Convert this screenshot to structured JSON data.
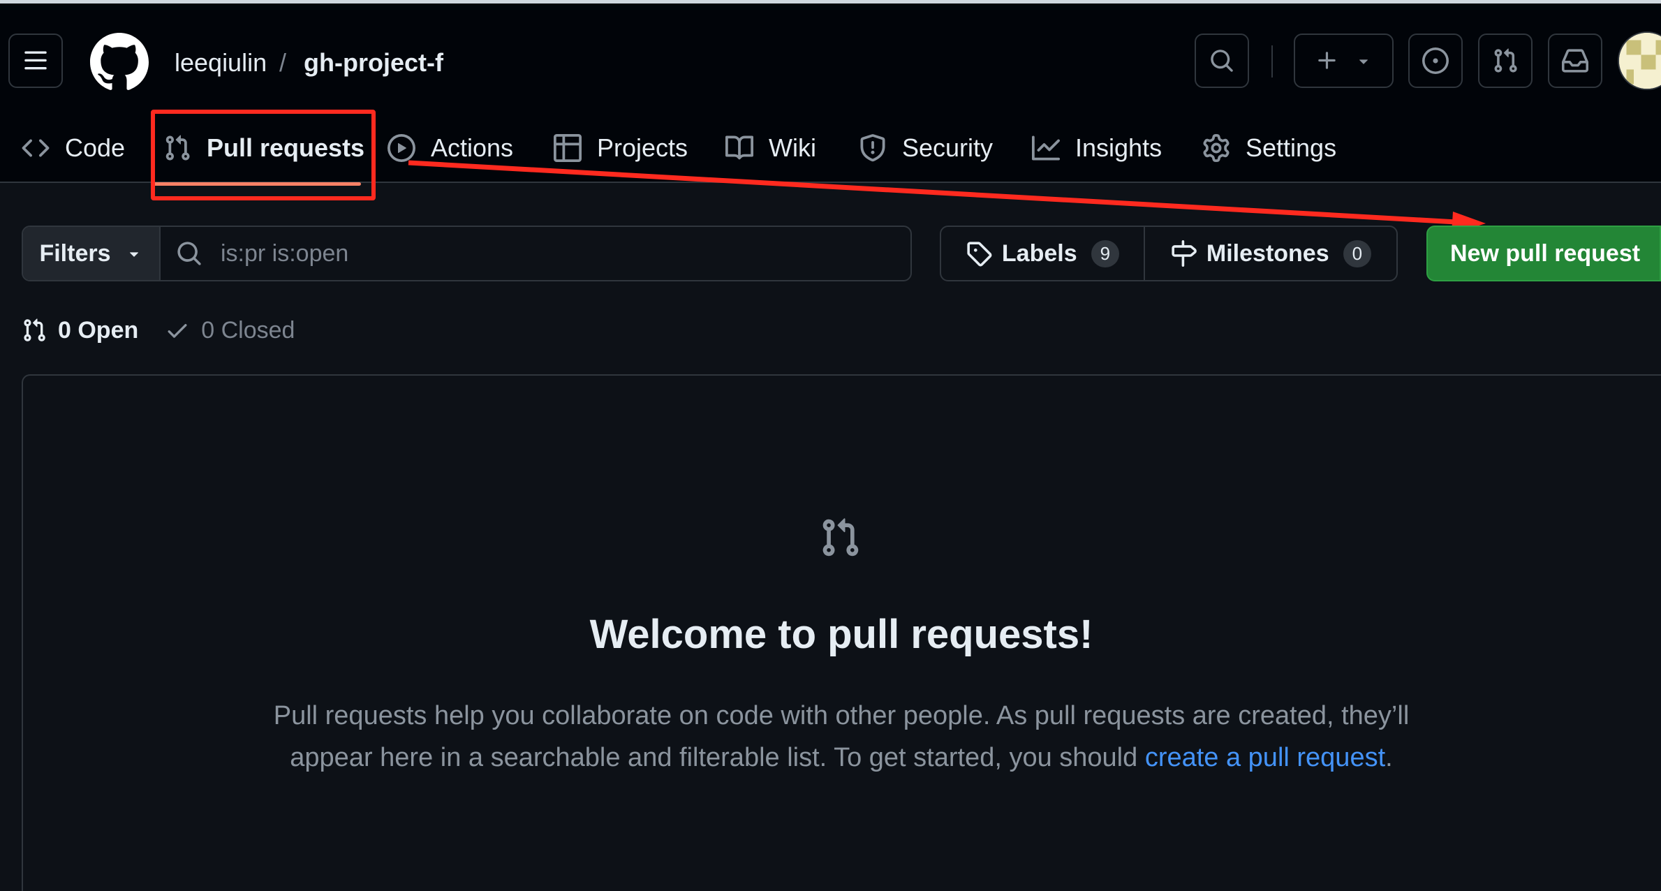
{
  "header": {
    "owner": "leeqiulin",
    "separator": "/",
    "repo": "gh-project-f"
  },
  "nav": {
    "items": [
      {
        "label": "Code",
        "icon": "code-icon"
      },
      {
        "label": "Pull requests",
        "icon": "git-pull-request-icon",
        "active": true
      },
      {
        "label": "Actions",
        "icon": "play-icon"
      },
      {
        "label": "Projects",
        "icon": "table-icon"
      },
      {
        "label": "Wiki",
        "icon": "book-icon"
      },
      {
        "label": "Security",
        "icon": "shield-icon"
      },
      {
        "label": "Insights",
        "icon": "graph-icon"
      },
      {
        "label": "Settings",
        "icon": "gear-icon"
      }
    ]
  },
  "filters": {
    "button_label": "Filters",
    "search_value": "is:pr is:open",
    "labels_label": "Labels",
    "labels_count": "9",
    "milestones_label": "Milestones",
    "milestones_count": "0",
    "new_pr_label": "New pull request"
  },
  "state": {
    "open_label": "0 Open",
    "closed_label": "0 Closed"
  },
  "blankslate": {
    "title": "Welcome to pull requests!",
    "text_before": "Pull requests help you collaborate on code with other people. As pull requests are created, they’ll appear here in a searchable and filterable list. To get started, you should ",
    "link_text": "create a pull request",
    "text_after": "."
  },
  "colors": {
    "background": "#0d1117",
    "header": "#010409",
    "accent_underline": "#f78166",
    "primary_button": "#238636",
    "link": "#4493f8",
    "annotation": "#ff2a1f"
  }
}
